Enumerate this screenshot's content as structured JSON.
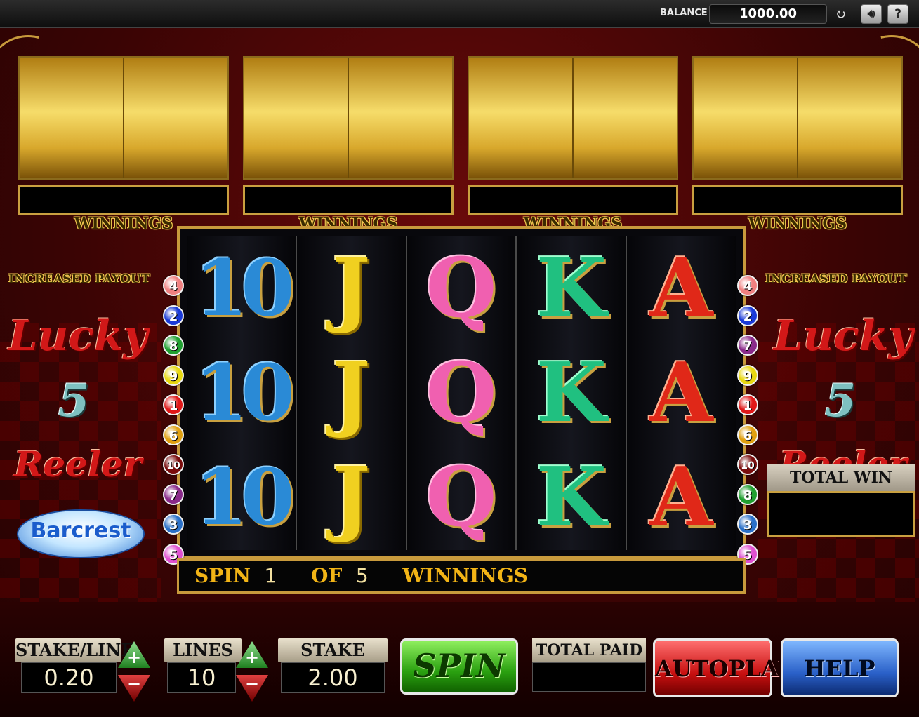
{
  "topbar": {
    "balance_label": "BALANCE",
    "balance_value": "1000.00",
    "refresh_icon": "refresh-icon",
    "sound_icon": "speaker-icon",
    "help_icon": "question-icon"
  },
  "bonus_reels": [
    {
      "winnings_label": "WINNINGS"
    },
    {
      "winnings_label": "WINNINGS"
    },
    {
      "winnings_label": "WINNINGS"
    },
    {
      "winnings_label": "WINNINGS"
    }
  ],
  "left_panel": {
    "increased_payout": "INCREASED PAYOUT",
    "logo_lucky": "Lucky",
    "logo_five": "5",
    "logo_reeler": "Reeler",
    "brand": "Barcrest"
  },
  "right_panel": {
    "increased_payout": "INCREASED PAYOUT",
    "logo_lucky": "Lucky",
    "logo_five": "5",
    "logo_reeler": "Reeler",
    "total_win_label": "TOTAL WIN"
  },
  "reels": [
    [
      "10",
      "10",
      "10"
    ],
    [
      "J",
      "J",
      "J"
    ],
    [
      "Q",
      "Q",
      "Q"
    ],
    [
      "K",
      "K",
      "K"
    ],
    [
      "A",
      "A",
      "A"
    ]
  ],
  "line_markers_left": [
    {
      "n": "4",
      "color": "#f08080"
    },
    {
      "n": "2",
      "color": "#1a3ad8"
    },
    {
      "n": "8",
      "color": "#20a030"
    },
    {
      "n": "9",
      "color": "#e8d810"
    },
    {
      "n": "1",
      "color": "#e01818"
    },
    {
      "n": "6",
      "color": "#e0a010"
    },
    {
      "n": "10",
      "color": "#7a0c0c"
    },
    {
      "n": "7",
      "color": "#8a2a8a"
    },
    {
      "n": "3",
      "color": "#2a70c8"
    },
    {
      "n": "5",
      "color": "#e050d0"
    }
  ],
  "line_markers_right": [
    {
      "n": "4",
      "color": "#f08080"
    },
    {
      "n": "2",
      "color": "#1a3ad8"
    },
    {
      "n": "7",
      "color": "#8a2a8a"
    },
    {
      "n": "9",
      "color": "#e8d810"
    },
    {
      "n": "1",
      "color": "#e01818"
    },
    {
      "n": "6",
      "color": "#e0a010"
    },
    {
      "n": "10",
      "color": "#7a0c0c"
    },
    {
      "n": "8",
      "color": "#20a030"
    },
    {
      "n": "3",
      "color": "#2a70c8"
    },
    {
      "n": "5",
      "color": "#e050d0"
    }
  ],
  "spin_info": {
    "spin_word": "SPIN",
    "spin_num": "1",
    "of_word": "OF",
    "of_num": "5",
    "winnings_word": "WINNINGS"
  },
  "controls": {
    "stake_line_label": "STAKE/LINE",
    "stake_line_value": "0.20",
    "lines_label": "LINES",
    "lines_value": "10",
    "stake_label": "STAKE",
    "stake_value": "2.00",
    "spin_label": "SPIN",
    "total_paid_label": "TOTAL PAID",
    "autoplay_label": "AUTOPLAY",
    "help_label": "HELP",
    "plus_glyph": "+",
    "minus_glyph": "−"
  }
}
